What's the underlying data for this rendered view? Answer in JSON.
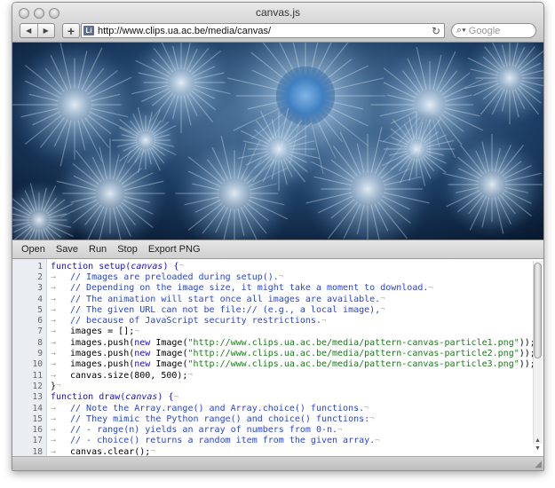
{
  "window": {
    "title": "canvas.js"
  },
  "toolbar": {
    "back_icon": "back-arrow-icon",
    "forward_icon": "forward-arrow-icon",
    "add_icon": "plus-icon",
    "favicon_text": "Li",
    "url": "http://www.clips.ua.ac.be/media/canvas/",
    "reload_icon": "reload-icon",
    "search_placeholder": "Google"
  },
  "menu": {
    "items": [
      "Open",
      "Save",
      "Run",
      "Stop",
      "Export PNG"
    ]
  },
  "code_lines": [
    "1",
    "2",
    "3",
    "4",
    "5",
    "6",
    "7",
    "8",
    "9",
    "10",
    "11",
    "12",
    "13",
    "14",
    "15",
    "16",
    "17",
    "18"
  ],
  "code": {
    "l1": {
      "a": "function ",
      "b": "setup(",
      "c": "canvas",
      "d": ") {"
    },
    "l2": "// Images are preloaded during setup().",
    "l3": "// Depending on the image size, it might take a moment to download.",
    "l4": "// The animation will start once all images are available.",
    "l5": "// The given URL can not be file:// (e.g., a local image),",
    "l6": "// because of JavaScript security restrictions.",
    "l7": "images = [];",
    "l8": {
      "a": "images.push(",
      "b": "new ",
      "c": "Image(",
      "d": "\"http://www.clips.ua.ac.be/media/pattern-canvas-particle1.png\"",
      "e": "));"
    },
    "l9": {
      "a": "images.push(",
      "b": "new ",
      "c": "Image(",
      "d": "\"http://www.clips.ua.ac.be/media/pattern-canvas-particle2.png\"",
      "e": "));"
    },
    "l10": {
      "a": "images.push(",
      "b": "new ",
      "c": "Image(",
      "d": "\"http://www.clips.ua.ac.be/media/pattern-canvas-particle3.png\"",
      "e": "));"
    },
    "l11": "canvas.size(800, 500);",
    "l12": "}",
    "l13": {
      "a": "function ",
      "b": "draw(",
      "c": "canvas",
      "d": ") {"
    },
    "l14": "// Note the Array.range() and Array.choice() functions.",
    "l15": "// They mimic the Python range() and choice() functions:",
    "l16": "// - range(n) yields an array of numbers from 0-n.",
    "l17": "// - choice() returns a random item from the given array.",
    "l18": "canvas.clear();"
  },
  "glyphs": {
    "tab": "→",
    "eol": "¬"
  },
  "colors": {
    "keyword": "#1a0fd1",
    "comment": "#2a44d6",
    "string": "#1a7a1a",
    "canvas_bg": "#0a1f3b"
  }
}
